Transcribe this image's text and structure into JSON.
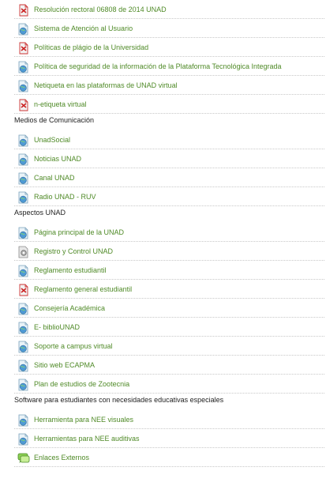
{
  "items": [
    {
      "label": "Resolución rectoral 06808 de 2014 UNAD",
      "icon": "pdf-icon"
    },
    {
      "label": "Sistema de Atención al Usuario",
      "icon": "web-icon"
    },
    {
      "label": "Políticas de plágio de la Universidad",
      "icon": "pdf-icon"
    },
    {
      "label": "Política de seguridad de la información de la Plataforma Tecnológica Integrada",
      "icon": "web-icon"
    },
    {
      "label": "Netiqueta en las plataformas de UNAD virtual",
      "icon": "web-icon"
    },
    {
      "label": "n-etiqueta virtual",
      "icon": "pdf-icon"
    }
  ],
  "sections": [
    {
      "title": "Medios de Comunicación",
      "items": [
        {
          "label": "UnadSocial",
          "icon": "web-icon"
        },
        {
          "label": "Noticias UNAD",
          "icon": "web-icon"
        },
        {
          "label": "Canal UNAD",
          "icon": "web-icon"
        },
        {
          "label": "Radio UNAD - RUV",
          "icon": "web-icon"
        }
      ]
    },
    {
      "title": "Aspectos UNAD",
      "items": [
        {
          "label": "Página principal de la UNAD",
          "icon": "web-icon"
        },
        {
          "label": "Registro y Control UNAD",
          "icon": "settings-icon"
        },
        {
          "label": "Reglamento estudiantil",
          "icon": "web-icon"
        },
        {
          "label": "Reglamento general estudiantil",
          "icon": "pdf-icon"
        },
        {
          "label": "Consejería Académica",
          "icon": "web-icon"
        },
        {
          "label": "E- biblioUNAD",
          "icon": "web-icon"
        },
        {
          "label": "Soporte a campus virtual",
          "icon": "web-icon"
        },
        {
          "label": "Sitio web ECAPMA",
          "icon": "web-icon"
        },
        {
          "label": "Plan de estudios de Zootecnia",
          "icon": "web-icon"
        }
      ]
    },
    {
      "title": "Software para estudiantes con necesidades educativas especiales",
      "items": [
        {
          "label": "Herramienta para NEE visuales",
          "icon": "web-icon"
        },
        {
          "label": "Herramientas para NEE auditivas",
          "icon": "web-icon"
        },
        {
          "label": "Enlaces Externos",
          "icon": "chat-icon"
        }
      ]
    }
  ],
  "colors": {
    "link": "#4f8a27",
    "section_text": "#222222",
    "divider": "#c8c8c8"
  }
}
